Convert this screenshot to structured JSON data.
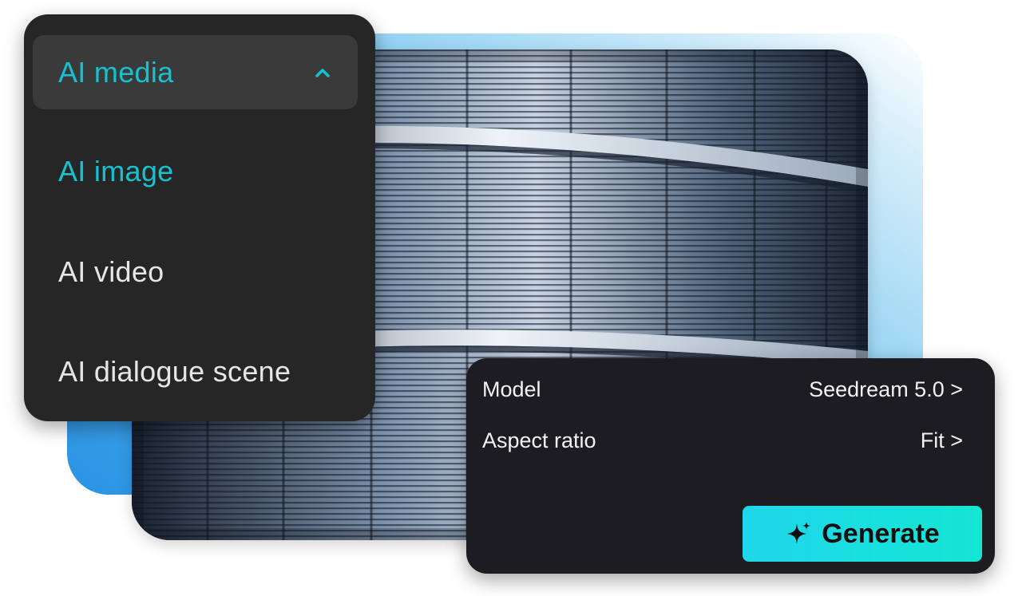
{
  "menu": {
    "header_label": "AI media",
    "items": [
      {
        "label": "AI image",
        "active": true
      },
      {
        "label": "AI video",
        "active": false
      },
      {
        "label": "AI dialogue scene",
        "active": false
      }
    ]
  },
  "settings": {
    "rows": [
      {
        "label": "Model",
        "value": "Seedream 5.0 >"
      },
      {
        "label": "Aspect ratio",
        "value": "Fit >"
      }
    ],
    "generate_label": "Generate"
  },
  "colors": {
    "accent": "#16c2cf",
    "panel_bg": "#262626",
    "settings_bg": "#1c1c21",
    "button_gradient_start": "#1fd6ec",
    "button_gradient_end": "#14e6d2",
    "backdrop_blue": "#2a93e4"
  },
  "icons": {
    "menu_toggle": "chevron-up-icon",
    "generate": "sparkle-icon"
  }
}
